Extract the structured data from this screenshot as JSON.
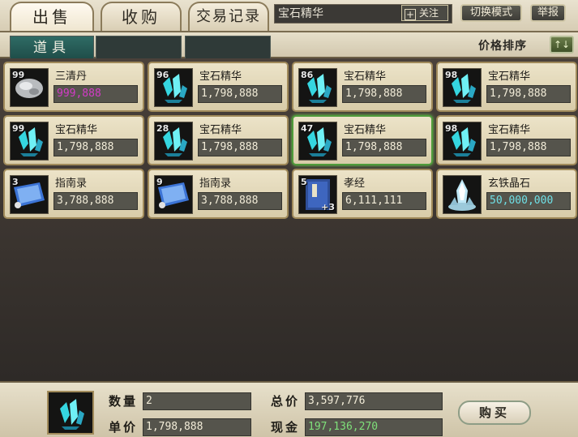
{
  "tabs": [
    "出售",
    "收购",
    "交易记录"
  ],
  "search": {
    "value": "宝石精华",
    "follow": "关注",
    "follow_plus": "+"
  },
  "buttons": {
    "switch_mode": "切换模式",
    "report": "举报"
  },
  "subtabs": {
    "active": "道具"
  },
  "sort": {
    "label": "价格排序",
    "icon": "↑↓"
  },
  "items": [
    {
      "qty": "99",
      "name": "三清丹",
      "price": "999,888",
      "price_color": "#d33bc7",
      "icon": "stone-icon"
    },
    {
      "qty": "96",
      "name": "宝石精华",
      "price": "1,798,888",
      "price_color": "#f2ecd8",
      "icon": "crystal-icon"
    },
    {
      "qty": "86",
      "name": "宝石精华",
      "price": "1,798,888",
      "price_color": "#f2ecd8",
      "icon": "crystal-icon"
    },
    {
      "qty": "98",
      "name": "宝石精华",
      "price": "1,798,888",
      "price_color": "#f2ecd8",
      "icon": "crystal-icon"
    },
    {
      "qty": "99",
      "name": "宝石精华",
      "price": "1,798,888",
      "price_color": "#f2ecd8",
      "icon": "crystal-icon"
    },
    {
      "qty": "28",
      "name": "宝石精华",
      "price": "1,798,888",
      "price_color": "#f2ecd8",
      "icon": "crystal-icon"
    },
    {
      "qty": "47",
      "name": "宝石精华",
      "price": "1,798,888",
      "price_color": "#f2ecd8",
      "icon": "crystal-icon"
    },
    {
      "qty": "98",
      "name": "宝石精华",
      "price": "1,798,888",
      "price_color": "#f2ecd8",
      "icon": "crystal-icon"
    },
    {
      "qty": "3",
      "name": "指南录",
      "price": "3,788,888",
      "price_color": "#f2ecd8",
      "icon": "scroll-icon"
    },
    {
      "qty": "9",
      "name": "指南录",
      "price": "3,788,888",
      "price_color": "#f2ecd8",
      "icon": "scroll-icon"
    },
    {
      "qty": "5",
      "name": "孝经",
      "price": "6,111,111",
      "price_color": "#f2ecd8",
      "icon": "book-icon",
      "plus": "+3"
    },
    {
      "qty": "",
      "name": "玄铁晶石",
      "price": "50,000,000",
      "price_color": "#6fe0e6",
      "icon": "iron-crystal-icon"
    }
  ],
  "selected_index": 6,
  "footer": {
    "qty_label": "数量",
    "qty_value": "2",
    "unit_price_label": "单价",
    "unit_price_value": "1,798,888",
    "total_label": "总价",
    "total_value": "3,597,776",
    "cash_label": "现金",
    "cash_value": "197,136,270",
    "cash_color": "#7fe07a",
    "buy_label": "购买",
    "thumb_icon": "crystal-icon"
  }
}
